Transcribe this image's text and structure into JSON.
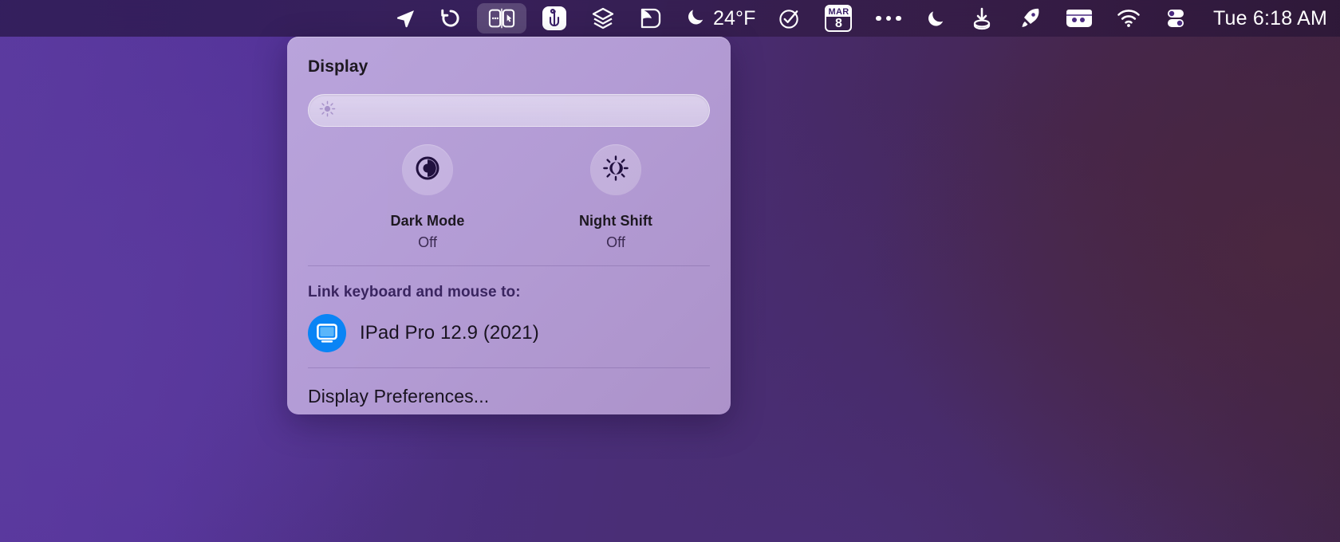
{
  "menubar": {
    "items": [
      {
        "name": "location-arrow-icon",
        "icon": "location-arrow",
        "label": ""
      },
      {
        "name": "time-machine-icon",
        "icon": "counterclockwise-arrow",
        "label": ""
      },
      {
        "name": "universal-control-icon",
        "icon": "universal-control",
        "label": "",
        "active": true
      },
      {
        "name": "trident-app-icon",
        "icon": "trident",
        "label": ""
      },
      {
        "name": "layers-icon",
        "icon": "layers",
        "label": ""
      },
      {
        "name": "shape-tool-icon",
        "icon": "folded-shape",
        "label": ""
      }
    ],
    "weather": {
      "icon": "moon-icon",
      "temperature": "24°F"
    },
    "items_right": [
      {
        "name": "checkmark-circle-icon",
        "icon": "check-circle",
        "label": ""
      },
      {
        "name": "calendar-icon",
        "icon": "calendar",
        "month": "MAR",
        "day": "8"
      },
      {
        "name": "more-options-icon",
        "icon": "ellipsis",
        "label": ""
      },
      {
        "name": "do-not-disturb-icon",
        "icon": "moon",
        "label": ""
      },
      {
        "name": "downloads-icon",
        "icon": "download-tray",
        "label": ""
      },
      {
        "name": "rocket-launcher-icon",
        "icon": "rocket",
        "label": ""
      },
      {
        "name": "wallet-icon",
        "icon": "wallet",
        "label": ""
      },
      {
        "name": "wifi-icon",
        "icon": "wifi",
        "label": ""
      },
      {
        "name": "control-center-icon",
        "icon": "toggles",
        "label": ""
      }
    ],
    "clock": "Tue 6:18 AM"
  },
  "popover": {
    "title": "Display",
    "brightness": {
      "name": "brightness-slider",
      "icon": "sun-icon",
      "value": 0
    },
    "toggles": [
      {
        "name": "dark-mode-toggle",
        "icon": "contrast-circle-icon",
        "label": "Dark Mode",
        "state": "Off"
      },
      {
        "name": "night-shift-toggle",
        "icon": "sun-moon-icon",
        "label": "Night Shift",
        "state": "Off"
      }
    ],
    "link_section": {
      "title": "Link keyboard and mouse to:",
      "device": {
        "icon": "ipad-display-icon",
        "name": "IPad Pro 12.9 (2021)"
      }
    },
    "preferences_link": "Display Preferences..."
  },
  "colors": {
    "accent_blue": "#0a84f5",
    "panel_bg": "#bda8dd",
    "menubar_bg": "#2e1b54",
    "text_dark": "#1d1820",
    "text_purple": "#3a2560"
  }
}
